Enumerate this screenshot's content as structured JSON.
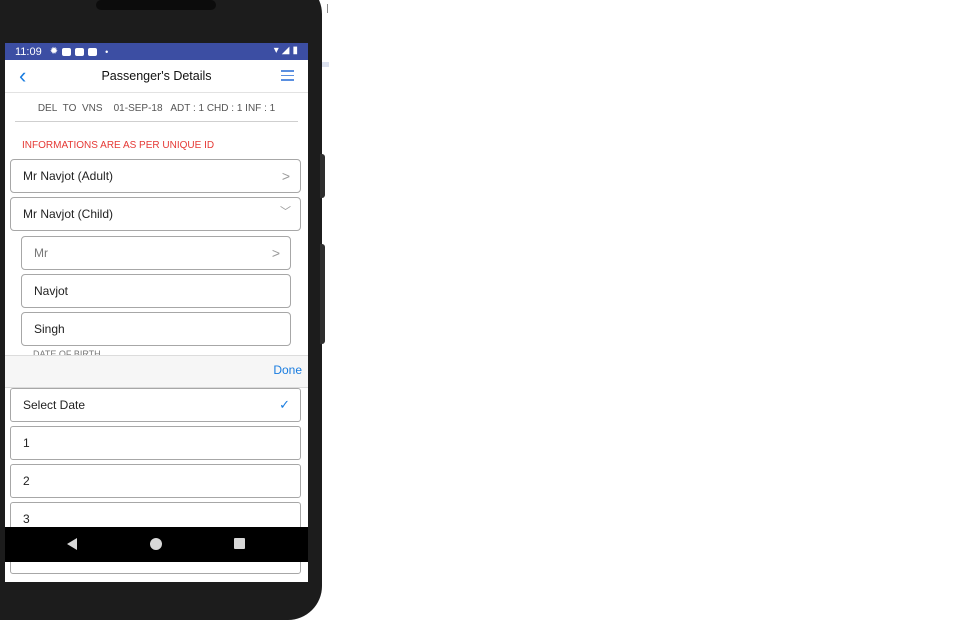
{
  "status_bar": {
    "time": "11:09",
    "app_icons": [
      "gear-icon",
      "app-icon",
      "app-icon",
      "app-icon"
    ],
    "dot": "•",
    "right_icons": [
      "wifi-icon",
      "signal-icon",
      "battery-icon"
    ]
  },
  "header": {
    "back_icon": "‹",
    "title": "Passenger's Details",
    "menu_icon": "list-icon"
  },
  "route": {
    "from": "DEL",
    "to_label": "TO",
    "to": "VNS",
    "date": "01-SEP-18",
    "pax": "ADT : 1 CHD : 1 INF : 1"
  },
  "notice": "INFORMATIONS ARE AS PER UNIQUE ID",
  "passengers": [
    {
      "label": "Mr Navjot (Adult)",
      "state": "collapsed"
    },
    {
      "label": "Mr Navjot (Child)",
      "state": "expanded"
    }
  ],
  "child_form": {
    "title_value": "Mr",
    "first_name": "Navjot",
    "last_name": "Singh",
    "dob_label": "DATE OF BIRTH"
  },
  "picker": {
    "done_label": "Done",
    "options": [
      "Select Date",
      "1",
      "2",
      "3"
    ],
    "selected": "Select Date"
  },
  "colors": {
    "status_bar": "#3c4ea3",
    "accent": "#1a7de0",
    "notice": "#e53935"
  }
}
